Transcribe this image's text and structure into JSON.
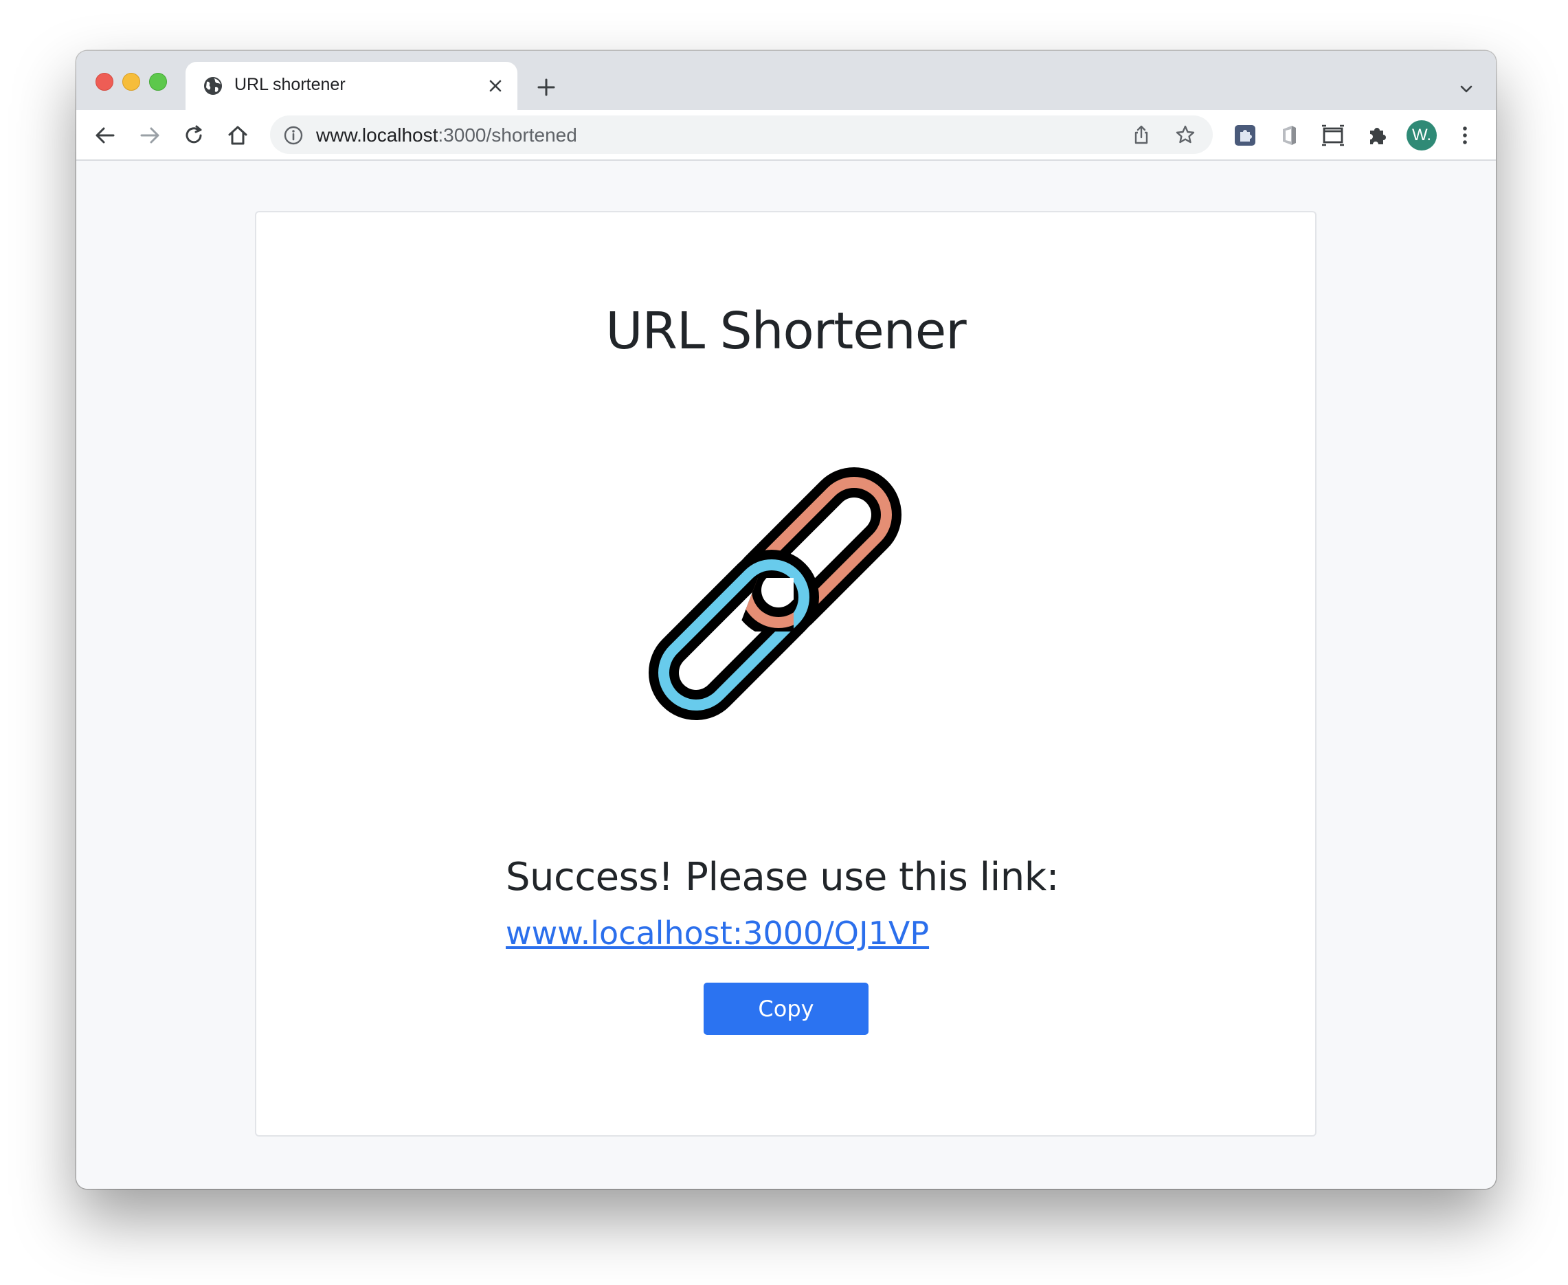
{
  "browser": {
    "tab": {
      "title": "URL shortener",
      "icon": "globe-icon"
    },
    "address": {
      "host": "www.localhost",
      "rest": ":3000/shortened"
    },
    "avatar_label": "W."
  },
  "page": {
    "title": "URL Shortener",
    "illustration": "chain-link-icon",
    "success_message": "Success! Please use this link:",
    "short_link": "www.localhost:3000/OJ1VP",
    "copy_label": "Copy"
  },
  "colors": {
    "link": "#2b6fec",
    "button": "#2b73f1",
    "chain_orange": "#e58e74",
    "chain_blue": "#68cbec"
  }
}
